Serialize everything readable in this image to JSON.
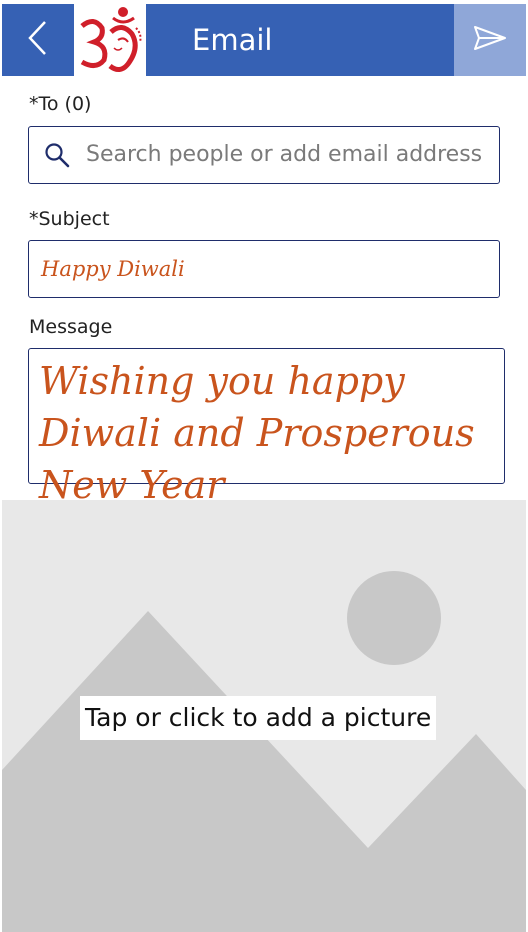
{
  "header": {
    "title": "Email",
    "back_icon": "chevron-left-icon",
    "send_icon": "send-icon",
    "logo": "om-ganesha-logo",
    "colors": {
      "bar": "#3661b4",
      "send_button": "#8fa7d8"
    }
  },
  "form": {
    "to_label": "*To (0)",
    "to_placeholder": "Search people or add email address",
    "subject_label": "*Subject",
    "subject_value": "Happy Diwali",
    "message_label": "Message",
    "message_value": "Wishing you happy Diwali and Prosperous New Year",
    "text_color": "#c9541d",
    "border_color": "#1f2d6b"
  },
  "picture": {
    "label": "Tap or click to add a picture",
    "icon": "image-placeholder-icon"
  }
}
